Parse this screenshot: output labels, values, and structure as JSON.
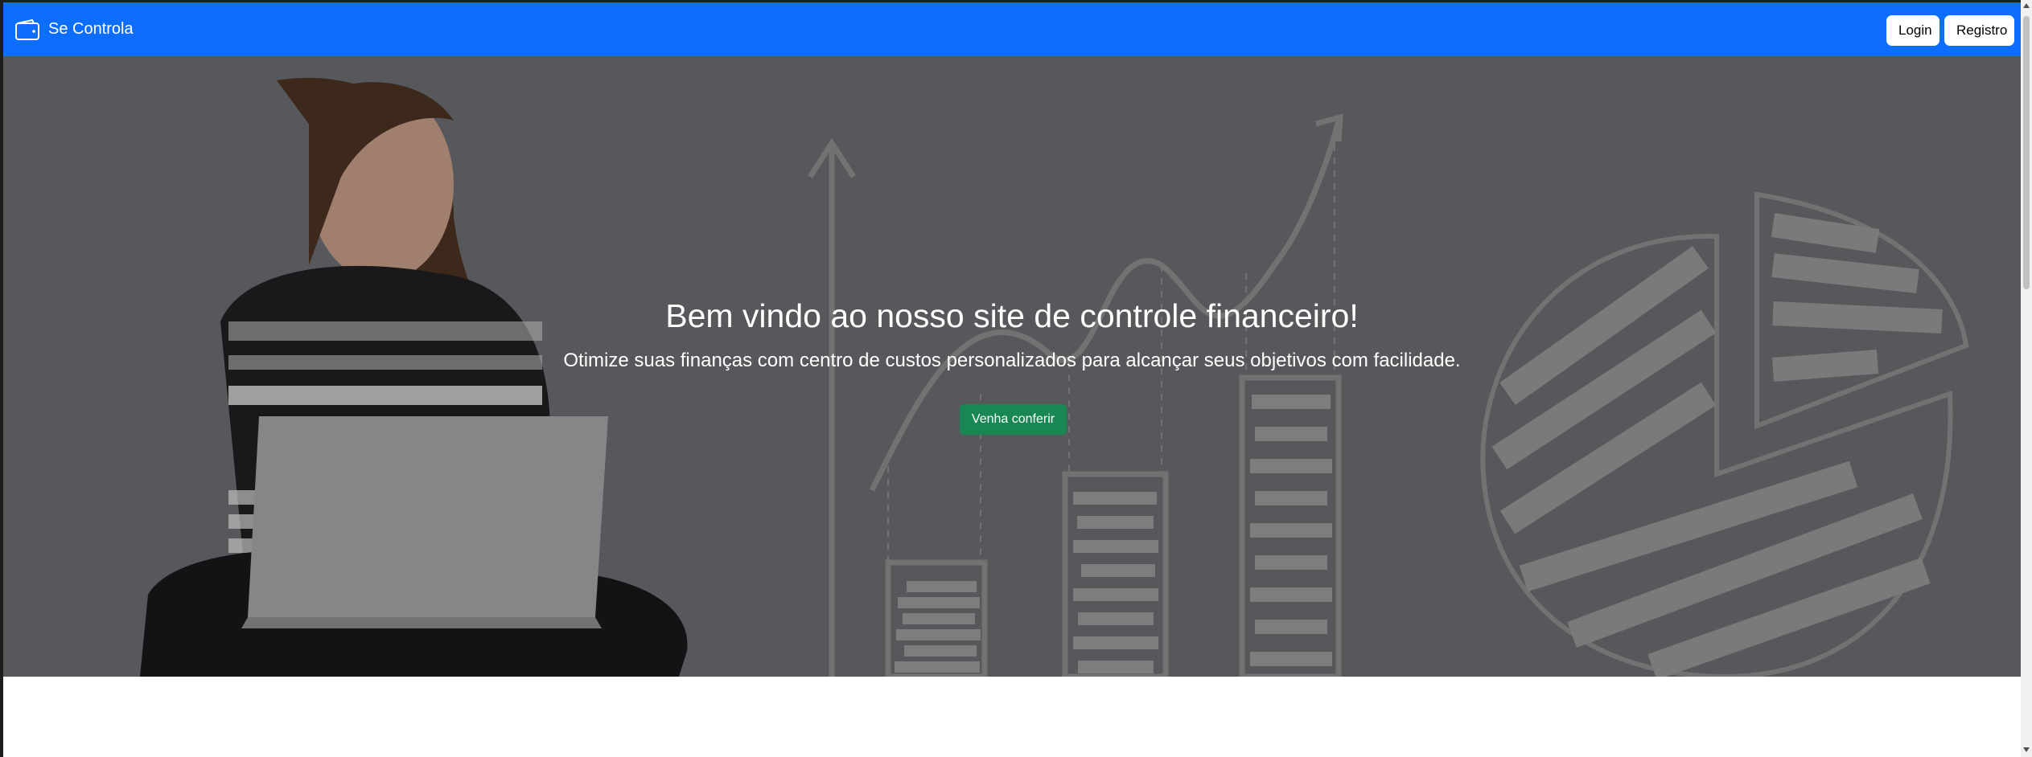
{
  "navbar": {
    "brand": "Se Controla",
    "brand_icon": "wallet-icon",
    "login_label": "Login",
    "register_label": "Registro",
    "color": "#0d6efd"
  },
  "hero": {
    "title": "Bem vindo ao nosso site de controle financeiro!",
    "subtitle": "Otimize suas finanças com centro de custos personalizados para alcançar seus objetivos com facilidade.",
    "cta_label": "Venha conferir",
    "cta_color": "#198754"
  }
}
